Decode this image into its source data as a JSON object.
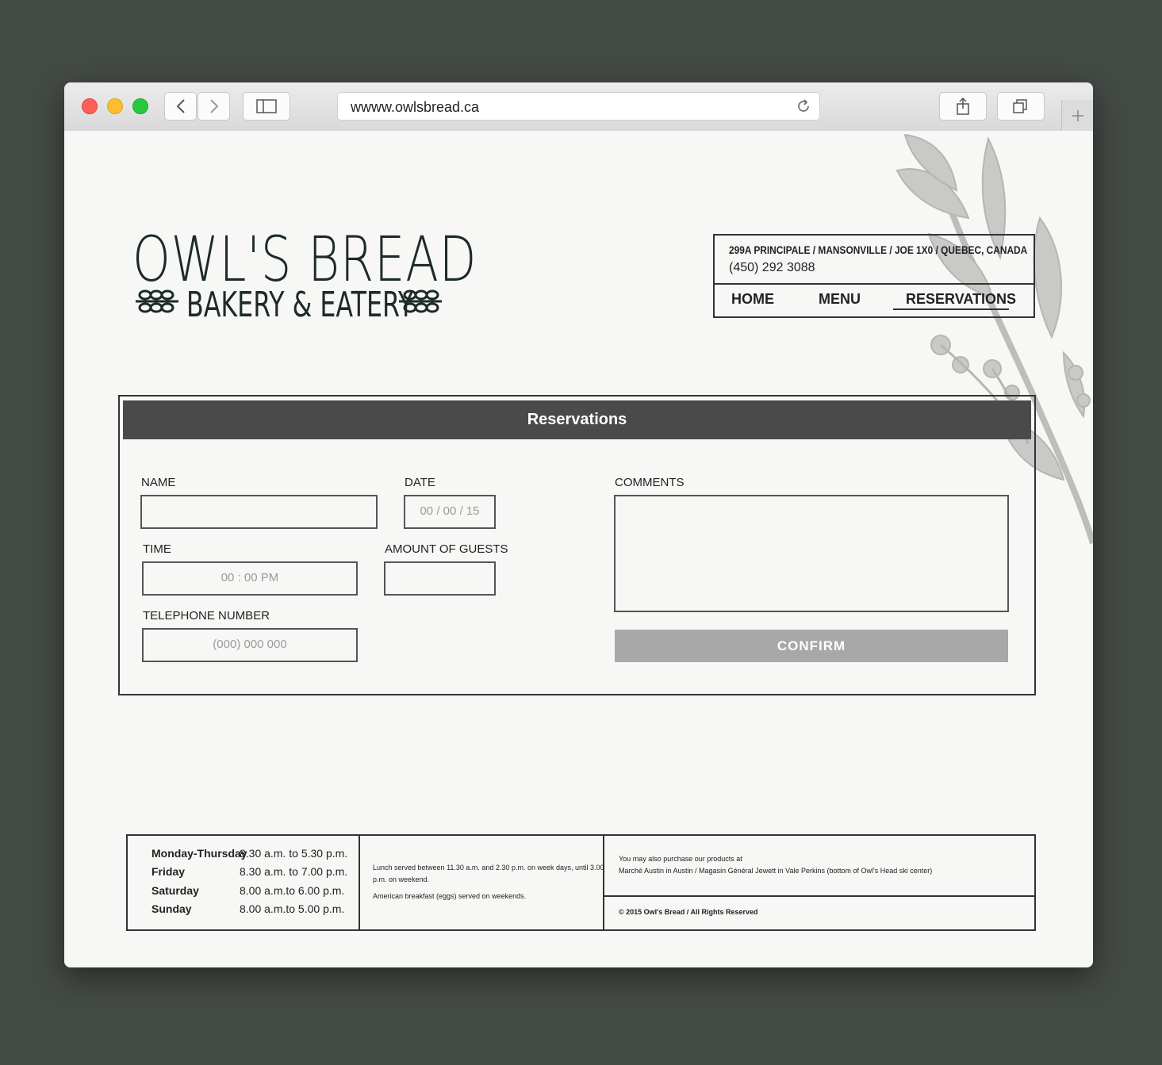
{
  "browser": {
    "url": "wwww.owlsbread.ca"
  },
  "logo": {
    "title": "OWL'S BREAD",
    "subtitle": "BAKERY & EATERY"
  },
  "header": {
    "address": "299A PRINCIPALE / MANSONVILLE /  JOE 1X0 / QUEBEC, CANADA",
    "phone": "(450) 292 3088",
    "nav": [
      {
        "label": "HOME"
      },
      {
        "label": "MENU"
      },
      {
        "label": "RESERVATIONS",
        "active": true
      }
    ]
  },
  "reservation": {
    "title": "Reservations",
    "name_label": "NAME",
    "date_label": "DATE",
    "date_placeholder": "00 / 00 / 15",
    "time_label": "TIME",
    "time_placeholder": "00 : 00 PM",
    "guests_label": "AMOUNT OF GUESTS",
    "phone_label": "TELEPHONE NUMBER",
    "phone_placeholder": "(000) 000 000",
    "comments_label": "COMMENTS",
    "confirm_label": "CONFIRM"
  },
  "footer": {
    "hours": [
      {
        "day": "Monday-Thursday",
        "time": "8.30 a.m. to 5.30 p.m."
      },
      {
        "day": "Friday",
        "time": "8.30 a.m. to 7.00 p.m."
      },
      {
        "day": "Saturday",
        "time": "8.00 a.m.to 6.00 p.m."
      },
      {
        "day": "Sunday",
        "time": "8.00 a.m.to 5.00 p.m."
      }
    ],
    "lunch_line1": "Lunch served between 11.30 a.m. and 2.30 p.m. on week days, until 3.00",
    "lunch_line2": "p.m. on weekend.",
    "breakfast": "American breakfast (eggs) served on weekends.",
    "purchase_line1": "You may also purchase our products at",
    "purchase_line2": "Marché Austin in Austin / Magasin Général Jewett in Vale Perkins (bottom of Owl's Head ski center)",
    "copyright": "© 2015 Owl's Bread / All Rights Reserved"
  },
  "colors": {
    "desktop": "#444a45",
    "header_bar": "#4a4a4a",
    "confirm_button": "#a8a8a8",
    "ink": "#1e2a2a"
  }
}
